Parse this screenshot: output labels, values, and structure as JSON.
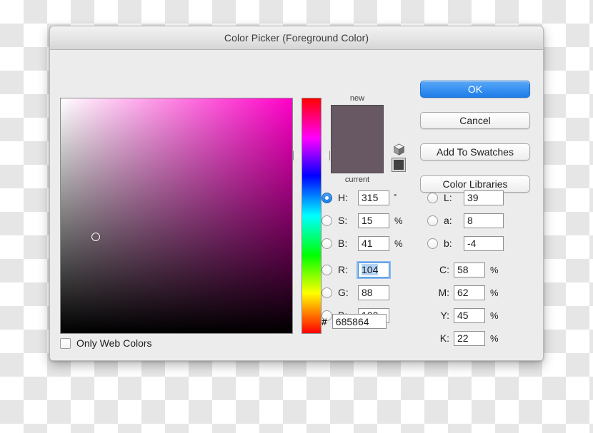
{
  "window": {
    "title": "Color Picker (Foreground Color)"
  },
  "preview": {
    "new_label": "new",
    "current_label": "current",
    "new_color": "#685864",
    "current_color": "#685864",
    "gamut_warning_icon": "cube-icon",
    "gamut_swatch_color": "#414141"
  },
  "picker": {
    "base_hue_color": "#ff00c8",
    "cursor_x_pct": 15,
    "cursor_y_pct": 59,
    "hue_marker_pct": 24.5
  },
  "web_colors": {
    "label": "Only Web Colors",
    "checked": false
  },
  "buttons": {
    "ok": "OK",
    "cancel": "Cancel",
    "add_to_swatches": "Add To Swatches",
    "color_libraries": "Color Libraries"
  },
  "hsb": [
    {
      "label": "H:",
      "value": "315",
      "unit": "°",
      "selected": true
    },
    {
      "label": "S:",
      "value": "15",
      "unit": "%",
      "selected": false
    },
    {
      "label": "B:",
      "value": "41",
      "unit": "%",
      "selected": false
    }
  ],
  "rgb": [
    {
      "label": "R:",
      "value": "104",
      "unit": "",
      "selected": false,
      "focused": true
    },
    {
      "label": "G:",
      "value": "88",
      "unit": "",
      "selected": false,
      "focused": false
    },
    {
      "label": "B:",
      "value": "100",
      "unit": "",
      "selected": false,
      "focused": false
    }
  ],
  "lab": [
    {
      "label": "L:",
      "value": "39",
      "unit": "",
      "selected": false
    },
    {
      "label": "a:",
      "value": "8",
      "unit": "",
      "selected": false
    },
    {
      "label": "b:",
      "value": "-4",
      "unit": "",
      "selected": false
    }
  ],
  "cmyk": [
    {
      "label": "C:",
      "value": "58",
      "unit": "%"
    },
    {
      "label": "M:",
      "value": "62",
      "unit": "%"
    },
    {
      "label": "Y:",
      "value": "45",
      "unit": "%"
    },
    {
      "label": "K:",
      "value": "22",
      "unit": "%"
    }
  ],
  "hex": {
    "prefix": "#",
    "value": "685864"
  },
  "colors": {
    "accent_blue": "#3b93f2",
    "dialog_bg": "#ececec",
    "titlebar_top": "#f2f2f2"
  }
}
